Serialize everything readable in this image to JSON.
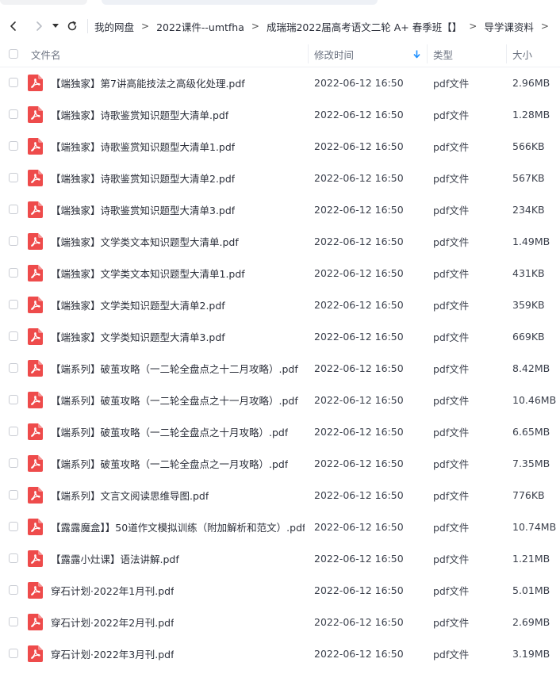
{
  "colors": {
    "accent": "#1e90ff",
    "pdf_icon": "#ee4b4b"
  },
  "nav": {
    "back_icon": "chevron-left-icon",
    "forward_icon": "chevron-right-icon",
    "dropdown_icon": "caret-down-icon",
    "refresh_icon": "refresh-icon"
  },
  "breadcrumb": [
    "我的网盘",
    "2022课件--umtfha",
    "成瑞瑞2022届高考语文二轮 A+ 春季班【】",
    "导学课资料"
  ],
  "breadcrumb_separator": ">",
  "columns": {
    "name": "文件名",
    "modified": "修改时间",
    "type": "类型",
    "size": "大小"
  },
  "sort_icon": "arrow-down-icon",
  "files": [
    {
      "name": "【端独家】第7讲高能技法之高级化处理.pdf",
      "modified": "2022-06-12 16:50",
      "type": "pdf文件",
      "size": "2.96MB"
    },
    {
      "name": "【端独家】诗歌鉴赏知识题型大清单.pdf",
      "modified": "2022-06-12 16:50",
      "type": "pdf文件",
      "size": "1.28MB"
    },
    {
      "name": "【端独家】诗歌鉴赏知识题型大清单1.pdf",
      "modified": "2022-06-12 16:50",
      "type": "pdf文件",
      "size": "566KB"
    },
    {
      "name": "【端独家】诗歌鉴赏知识题型大清单2.pdf",
      "modified": "2022-06-12 16:50",
      "type": "pdf文件",
      "size": "567KB"
    },
    {
      "name": "【端独家】诗歌鉴赏知识题型大清单3.pdf",
      "modified": "2022-06-12 16:50",
      "type": "pdf文件",
      "size": "234KB"
    },
    {
      "name": "【端独家】文学类文本知识题型大清单.pdf",
      "modified": "2022-06-12 16:50",
      "type": "pdf文件",
      "size": "1.49MB"
    },
    {
      "name": "【端独家】文学类文本知识题型大清单1.pdf",
      "modified": "2022-06-12 16:50",
      "type": "pdf文件",
      "size": "431KB"
    },
    {
      "name": "【端独家】文学类知识题型大清单2.pdf",
      "modified": "2022-06-12 16:50",
      "type": "pdf文件",
      "size": "359KB"
    },
    {
      "name": "【端独家】文学类知识题型大清单3.pdf",
      "modified": "2022-06-12 16:50",
      "type": "pdf文件",
      "size": "669KB"
    },
    {
      "name": "【端系列】破茧攻略（一二轮全盘点之十二月攻略）.pdf",
      "modified": "2022-06-12 16:50",
      "type": "pdf文件",
      "size": "8.42MB"
    },
    {
      "name": "【端系列】破茧攻略（一二轮全盘点之十一月攻略）.pdf",
      "modified": "2022-06-12 16:50",
      "type": "pdf文件",
      "size": "10.46MB"
    },
    {
      "name": "【端系列】破茧攻略（一二轮全盘点之十月攻略）.pdf",
      "modified": "2022-06-12 16:50",
      "type": "pdf文件",
      "size": "6.65MB"
    },
    {
      "name": "【端系列】破茧攻略（一二轮全盘点之一月攻略）.pdf",
      "modified": "2022-06-12 16:50",
      "type": "pdf文件",
      "size": "7.35MB"
    },
    {
      "name": "【端系列】文言文阅读思维导图.pdf",
      "modified": "2022-06-12 16:50",
      "type": "pdf文件",
      "size": "776KB"
    },
    {
      "name": "【露露魔盒】】50道作文模拟训练（附加解析和范文）.pdf",
      "modified": "2022-06-12 16:50",
      "type": "pdf文件",
      "size": "10.74MB"
    },
    {
      "name": "【露露小灶课】语法讲解.pdf",
      "modified": "2022-06-12 16:50",
      "type": "pdf文件",
      "size": "1.21MB"
    },
    {
      "name": "穿石计划·2022年1月刊.pdf",
      "modified": "2022-06-12 16:50",
      "type": "pdf文件",
      "size": "5.01MB"
    },
    {
      "name": "穿石计划·2022年2月刊.pdf",
      "modified": "2022-06-12 16:50",
      "type": "pdf文件",
      "size": "2.69MB"
    },
    {
      "name": "穿石计划·2022年3月刊.pdf",
      "modified": "2022-06-12 16:50",
      "type": "pdf文件",
      "size": "3.19MB"
    }
  ]
}
